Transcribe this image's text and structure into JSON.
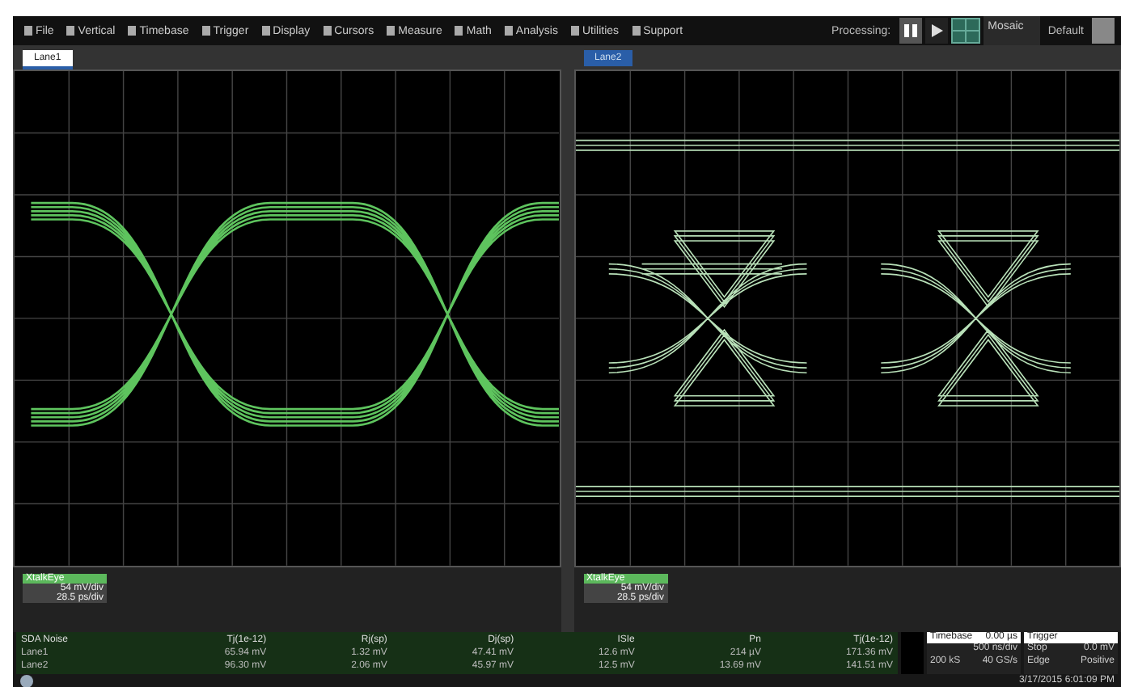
{
  "menu": [
    {
      "label": "File"
    },
    {
      "label": "Vertical"
    },
    {
      "label": "Timebase"
    },
    {
      "label": "Trigger"
    },
    {
      "label": "Display"
    },
    {
      "label": "Cursors"
    },
    {
      "label": "Measure"
    },
    {
      "label": "Math"
    },
    {
      "label": "Analysis"
    },
    {
      "label": "Utilities"
    },
    {
      "label": "Support"
    }
  ],
  "processing": {
    "label": "Processing:",
    "mode": "Mosaic",
    "preset": "Default"
  },
  "panes": [
    {
      "tab": {
        "label": "Lane1",
        "selected": true
      },
      "trace": {
        "name": "XtalkEye",
        "vdiv": "54 mV/div",
        "tdiv": "28.5 ps/div"
      },
      "kind": "two-level"
    },
    {
      "tab": {
        "label": "Lane2",
        "selected": false
      },
      "trace": {
        "name": "XtalkEye",
        "vdiv": "54 mV/div",
        "tdiv": "28.5 ps/div"
      },
      "kind": "four-level"
    }
  ],
  "table": {
    "columns": [
      "SDA Noise",
      "Tj(1e-12)",
      "Rj(sp)",
      "Dj(sp)",
      "ISIe",
      "Pn",
      "Tj(1e-12)"
    ],
    "rows": [
      [
        "Lane1",
        "65.94 mV",
        "1.32 mV",
        "47.41 mV",
        "12.6 mV",
        "214 µV",
        "171.36 mV"
      ],
      [
        "Lane2",
        "96.30 mV",
        "2.06 mV",
        "45.97 mV",
        "12.5 mV",
        "13.69 mV",
        "141.51 mV"
      ]
    ]
  },
  "timebase": {
    "title": "Timebase",
    "value": "0.00 µs",
    "scale": "500 ns/div",
    "samples": "200 kS",
    "rate": "40 GS/s"
  },
  "trigger": {
    "title": "Trigger",
    "mode": "Stop",
    "level": "0.0 mV",
    "type": "Edge",
    "slope": "Positive"
  },
  "status_bar": {
    "datetime": "3/17/2015 6:01:09 PM"
  }
}
